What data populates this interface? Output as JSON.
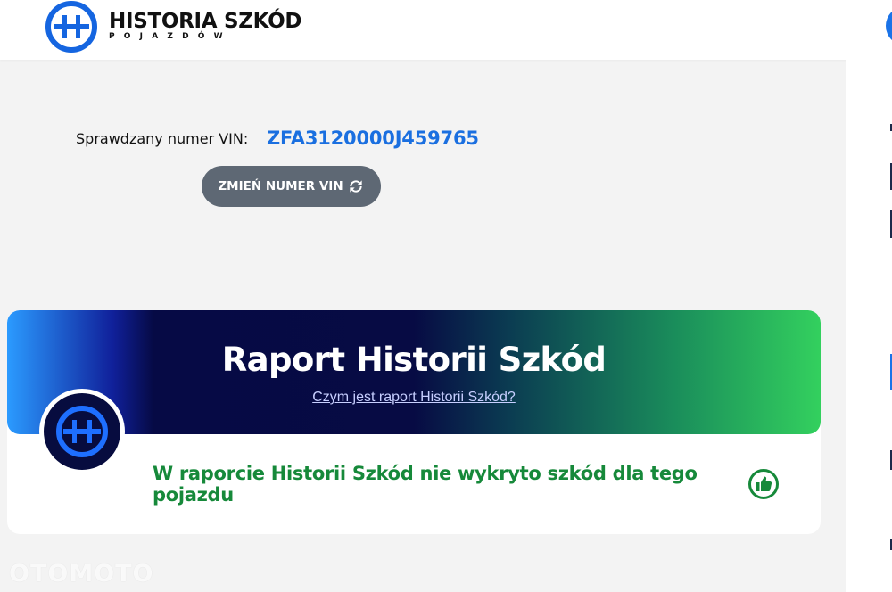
{
  "header": {
    "logo_title": "HISTORIA SZKÓD",
    "logo_subtitle": "POJAZDÓW",
    "logo_icon": "hs-logo-icon"
  },
  "vin": {
    "label": "Sprawdzany numer VIN:",
    "value": "ZFA3120000J459765",
    "change_button_label": "ZMIEŃ NUMER VIN",
    "change_button_icon": "refresh-icon"
  },
  "report": {
    "title": "Raport Historii Szkód",
    "link": "Czym jest raport Historii Szkód?",
    "result": "W raporcie Historii Szkód nie wykryto szkód dla tego pojazdu",
    "result_icon": "thumbs-up-icon",
    "colors": {
      "accent_blue": "#1a6fe0",
      "success_green": "#16893a",
      "banner_start": "#2b9bff",
      "banner_mid": "#060a45",
      "banner_end": "#33d05e"
    }
  },
  "watermark": "OTOMOTO"
}
